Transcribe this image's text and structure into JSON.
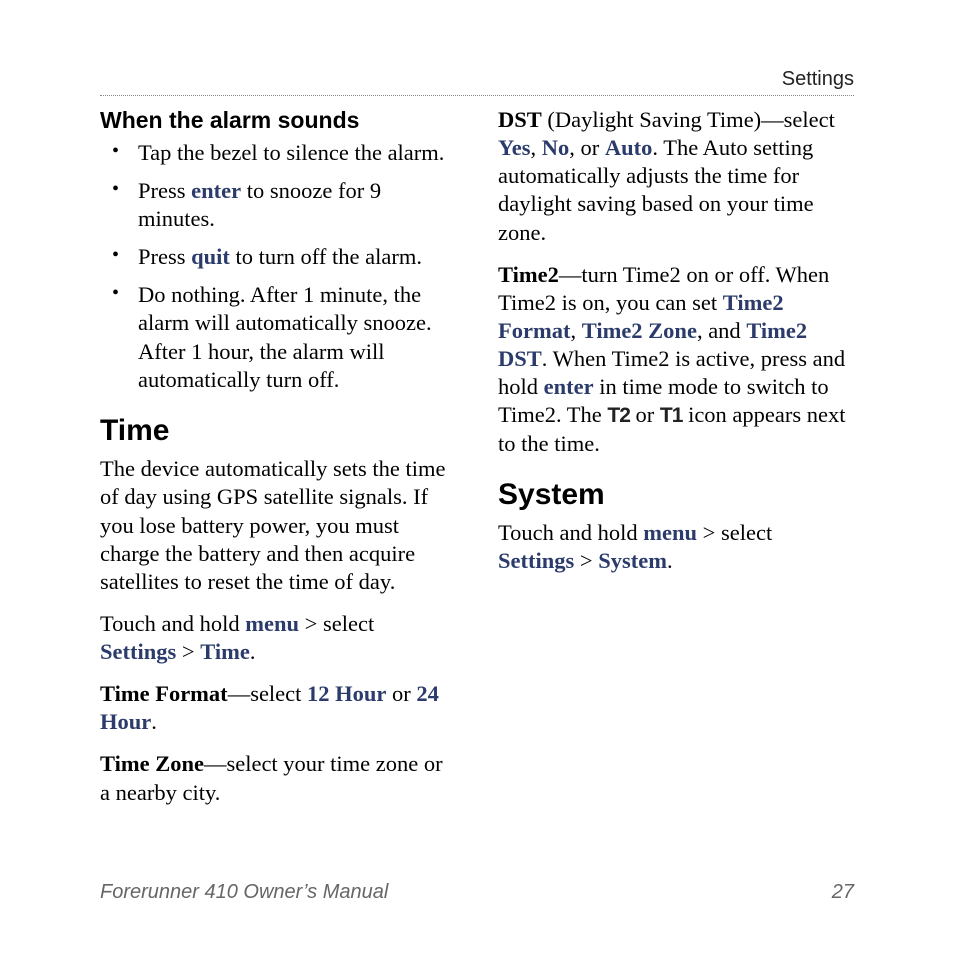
{
  "header": {
    "section": "Settings"
  },
  "col1": {
    "alarm_heading": "When the alarm sounds",
    "bullets": {
      "b1": "Tap the bezel to silence the alarm.",
      "b2_a": "Press ",
      "b2_key": "enter",
      "b2_b": " to snooze for 9 minutes.",
      "b3_a": "Press ",
      "b3_key": "quit",
      "b3_b": " to turn off the alarm.",
      "b4": "Do nothing. After 1 minute, the alarm will automatically snooze. After 1 hour, the alarm will automatically turn off."
    },
    "time_heading": "Time",
    "time_body": "The device automatically sets the time of day using GPS satellite signals. If you lose battery power, you must charge the battery and then acquire satellites to reset the time of day.",
    "time_nav_a": "Touch and hold ",
    "time_nav_menu": "menu",
    "time_nav_b": " > select ",
    "time_nav_settings": "Settings",
    "time_nav_gt": " > ",
    "time_nav_time": "Time",
    "time_nav_period": ".",
    "tf_label": "Time Format",
    "tf_mid": "—select ",
    "tf_12": "12 Hour",
    "tf_or": " or ",
    "tf_24": "24 Hour",
    "tf_period": "."
  },
  "col2": {
    "tz_label": "Time Zone",
    "tz_body": "—select your time zone or a nearby city.",
    "dst_label": "DST",
    "dst_a": " (Daylight Saving Time)—select ",
    "dst_yes": "Yes",
    "dst_c1": ", ",
    "dst_no": "No",
    "dst_c2": ", or ",
    "dst_auto": "Auto",
    "dst_b": ". The Auto setting automatically adjusts the time for daylight saving based on your time zone.",
    "t2_label": "Time2",
    "t2_a": "—turn Time2 on or off. When Time2 is on, you can set ",
    "t2_format": "Time2 Format",
    "t2_c1": ", ",
    "t2_zone": "Time2 Zone",
    "t2_c2": ", and ",
    "t2_dst": "Time2 DST",
    "t2_b": ". When Time2 is active, press and hold ",
    "t2_enter": "enter",
    "t2_c": " in time mode to switch to Time2. The ",
    "t2_icon2": "T2",
    "t2_or": " or ",
    "t2_icon1": "T1",
    "t2_d": " icon appears next to the time.",
    "sys_heading": "System",
    "sys_a": "Touch and hold ",
    "sys_menu": "menu",
    "sys_b": " > select ",
    "sys_settings": "Settings",
    "sys_gt": " > ",
    "sys_system": "System",
    "sys_period": "."
  },
  "footer": {
    "title": "Forerunner 410 Owner’s Manual",
    "page": "27"
  }
}
